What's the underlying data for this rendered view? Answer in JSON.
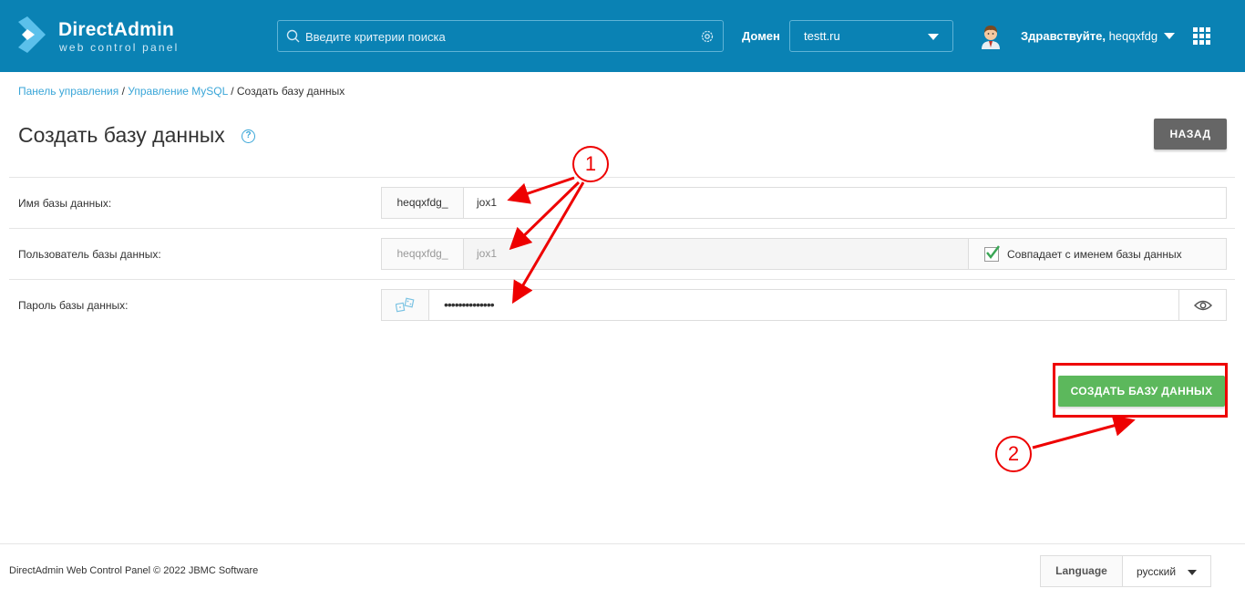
{
  "header": {
    "logo_title": "DirectAdmin",
    "logo_subtitle": "web control panel",
    "search_placeholder": "Введите критерии поиска",
    "domain_label": "Домен",
    "domain_value": "testt.ru",
    "greeting": "Здравствуйте,",
    "username": "heqqxfdg"
  },
  "breadcrumb": {
    "item1": "Панель управления",
    "sep1": " / ",
    "item2": "Управление MySQL",
    "sep2": " / ",
    "current": "Создать базу данных"
  },
  "page": {
    "title": "Создать базу данных",
    "help": "?",
    "back_label": "НАЗАД"
  },
  "form": {
    "db_name_label": "Имя базы данных:",
    "db_name_prefix": "heqqxfdg_",
    "db_name_value": "jox1",
    "db_user_label": "Пользователь базы данных:",
    "db_user_prefix": "heqqxfdg_",
    "db_user_value": "jox1",
    "db_user_match_label": "Совпадает с именем базы данных",
    "db_user_match_checked": true,
    "db_pass_label": "Пароль базы данных:",
    "db_pass_value": "••••••••••••••",
    "create_label": "СОЗДАТЬ БАЗУ ДАННЫХ"
  },
  "annotations": {
    "marker1": "1",
    "marker2": "2"
  },
  "footer": {
    "copyright": "DirectAdmin Web Control Panel © 2022 JBMC Software",
    "language_label": "Language",
    "language_value": "русский"
  },
  "colors": {
    "header_bg": "#0a82b4",
    "link": "#3aa6d8",
    "create_button": "#5cb85c",
    "back_button": "#666666",
    "annotation": "#ee0000"
  }
}
